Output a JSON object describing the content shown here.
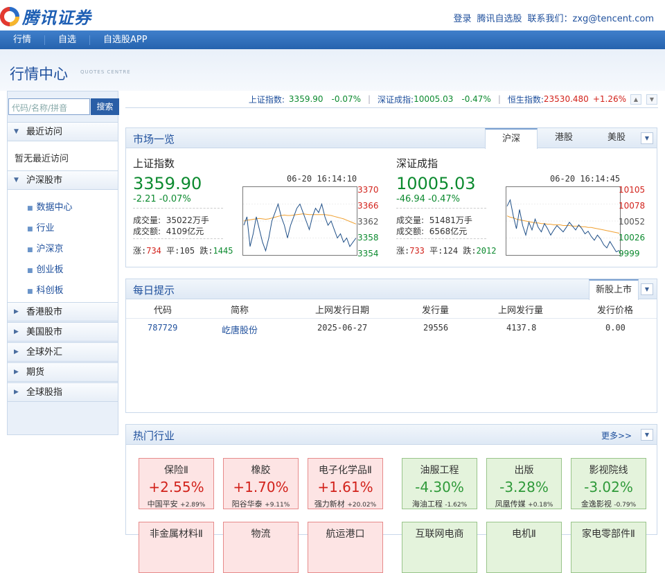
{
  "brand": {
    "logo_text": "腾讯证券"
  },
  "toplinks": {
    "login": "登录",
    "zixuan": "腾讯自选股",
    "contact": "联系我们：zxg@tencent.com"
  },
  "nav": [
    "行情",
    "自选",
    "自选股APP"
  ],
  "header": {
    "title": "行情中心",
    "subtitle": "QUOTES CENTRE"
  },
  "search": {
    "placeholder": "代码/名称/拼音",
    "button": "搜索"
  },
  "sidebar": {
    "recent": "最近访问",
    "recent_empty": "暂无最近访问",
    "hs": "沪深股市",
    "hs_items": [
      "数据中心",
      "行业",
      "沪深京",
      "创业板",
      "科创板"
    ],
    "groups": [
      "香港股市",
      "美国股市",
      "全球外汇",
      "期货",
      "全球股指"
    ]
  },
  "quotebar": {
    "sh_label": "上证指数:",
    "sh_val": "3359.90",
    "sh_chg": "-0.07%",
    "sz_label": "深证成指:",
    "sz_val": "10005.03",
    "sz_chg": "-0.47%",
    "hk_label": "恒生指数:",
    "hk_val": "23530.480",
    "hk_chg": "+1.26%"
  },
  "market": {
    "title": "市场一览",
    "tabs": [
      "沪深",
      "港股",
      "美股"
    ],
    "indices": [
      {
        "name": "上证指数",
        "value": "3359.90",
        "change": "-2.21 -0.07%",
        "vol_label": "成交量:",
        "vol": "35022万手",
        "amt_label": "成交额:",
        "amt": "4109亿元",
        "stats": {
          "up_label": "涨:",
          "up": "734",
          "flat_label": "平:",
          "flat": "105",
          "down_label": "跌:",
          "down": "1445"
        },
        "time": "06-20 16:14:10",
        "yticks": [
          "3370",
          "3366",
          "3362",
          "3358",
          "3354"
        ],
        "line": [
          3361,
          3363,
          3356,
          3359,
          3363,
          3360,
          3357,
          3355,
          3358,
          3362,
          3364,
          3366,
          3363,
          3361,
          3358,
          3361,
          3363,
          3365,
          3366,
          3364,
          3362,
          3360,
          3363,
          3365,
          3364,
          3366,
          3363,
          3361,
          3362,
          3360,
          3358,
          3359,
          3357,
          3358,
          3356,
          3357,
          3358
        ],
        "avg": [
          3362,
          3362.2,
          3362.3,
          3362.4,
          3362.5,
          3362.6,
          3362.5,
          3362.4,
          3362.5,
          3362.7,
          3362.9,
          3363.1,
          3363.3,
          3363.4,
          3363.3,
          3363.3,
          3363.4,
          3363.5,
          3363.6,
          3363.7,
          3363.6,
          3363.5,
          3363.5,
          3363.5,
          3363.5,
          3363.5,
          3363.5,
          3363.4,
          3363.3,
          3363.1,
          3362.9,
          3362.7,
          3362.5,
          3362.2,
          3361.9,
          3361.6,
          3361.3
        ],
        "ymin": 3354,
        "ymax": 3370
      },
      {
        "name": "深证成指",
        "value": "10005.03",
        "change": "-46.94 -0.47%",
        "vol_label": "成交量:",
        "vol": "51481万手",
        "amt_label": "成交额:",
        "amt": "6568亿元",
        "stats": {
          "up_label": "涨:",
          "up": "733",
          "flat_label": "平:",
          "flat": "124",
          "down_label": "跌:",
          "down": "2012"
        },
        "time": "06-20 16:14:45",
        "yticks": [
          "10105",
          "10078",
          "10052",
          "10026",
          "9999"
        ],
        "line": [
          10075,
          10085,
          10060,
          10040,
          10070,
          10045,
          10030,
          10050,
          10038,
          10055,
          10042,
          10035,
          10048,
          10040,
          10030,
          10038,
          10045,
          10040,
          10035,
          10042,
          10050,
          10044,
          10038,
          10046,
          10040,
          10032,
          10036,
          10028,
          10022,
          10030,
          10024,
          10015,
          10010,
          10020,
          10012,
          10004,
          10006
        ],
        "avg": [
          10060,
          10058,
          10057,
          10055,
          10054,
          10053,
          10052,
          10051,
          10050,
          10049,
          10049,
          10048,
          10048,
          10047,
          10047,
          10046,
          10046,
          10046,
          10045,
          10045,
          10045,
          10044,
          10044,
          10044,
          10043,
          10043,
          10042,
          10042,
          10041,
          10040,
          10039,
          10038,
          10037,
          10036,
          10035,
          10034,
          10033
        ],
        "ymin": 9999,
        "ymax": 10105
      }
    ]
  },
  "daily": {
    "title": "每日提示",
    "tab": "新股上市",
    "headers": [
      "代码",
      "简称",
      "上网发行日期",
      "发行量",
      "上网发行量",
      "发行价格"
    ],
    "rows": [
      [
        "787729",
        "屹唐股份",
        "2025-06-27",
        "29556",
        "4137.8",
        "0.00"
      ]
    ]
  },
  "hot": {
    "title": "热门行业",
    "more": "更多>>",
    "cards": [
      {
        "name": "保险Ⅱ",
        "pct": "+2.55%",
        "stock": "中国平安",
        "schg": "+2.89%",
        "color": "r"
      },
      {
        "name": "橡胶",
        "pct": "+1.70%",
        "stock": "阳谷华泰",
        "schg": "+9.11%",
        "color": "r"
      },
      {
        "name": "电子化学品Ⅱ",
        "pct": "+1.61%",
        "stock": "强力新材",
        "schg": "+20.02%",
        "color": "r"
      },
      {
        "name": "油服工程",
        "pct": "-4.30%",
        "stock": "海油工程",
        "schg": "-1.62%",
        "color": "g"
      },
      {
        "name": "出版",
        "pct": "-3.28%",
        "stock": "凤凰传媒",
        "schg": "+0.18%",
        "color": "g"
      },
      {
        "name": "影视院线",
        "pct": "-3.02%",
        "stock": "金逸影视",
        "schg": "-0.79%",
        "color": "g"
      },
      {
        "name": "非金属材料Ⅱ",
        "pct": "",
        "stock": "",
        "schg": "",
        "color": "r"
      },
      {
        "name": "物流",
        "pct": "",
        "stock": "",
        "schg": "",
        "color": "r"
      },
      {
        "name": "航运港口",
        "pct": "",
        "stock": "",
        "schg": "",
        "color": "r"
      },
      {
        "name": "互联网电商",
        "pct": "",
        "stock": "",
        "schg": "",
        "color": "g"
      },
      {
        "name": "电机Ⅱ",
        "pct": "",
        "stock": "",
        "schg": "",
        "color": "g"
      },
      {
        "name": "家电零部件Ⅱ",
        "pct": "",
        "stock": "",
        "schg": "",
        "color": "g"
      }
    ]
  },
  "colors": {
    "up": "#d2221b",
    "down": "#0c8a2f",
    "line": "#1f4f87",
    "avg": "#f0a030",
    "brand": "#1e5fb4"
  }
}
